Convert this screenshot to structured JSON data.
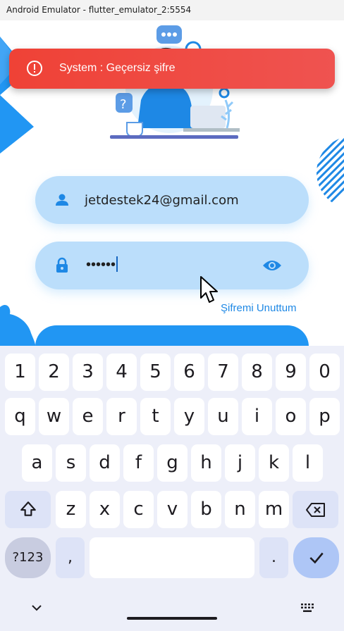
{
  "window": {
    "title": "Android Emulator - flutter_emulator_2:5554"
  },
  "snackbar": {
    "message": "System : Geçersiz şifre"
  },
  "login": {
    "email_value": "jetdestek24@gmail.com",
    "password_masked": "••••••",
    "forgot_label": "Şifremi Unuttum",
    "login_button_label": ""
  },
  "keyboard": {
    "number_row": [
      "1",
      "2",
      "3",
      "4",
      "5",
      "6",
      "7",
      "8",
      "9",
      "0"
    ],
    "row1": [
      "q",
      "w",
      "e",
      "r",
      "t",
      "y",
      "u",
      "i",
      "o",
      "p"
    ],
    "row2": [
      "a",
      "s",
      "d",
      "f",
      "g",
      "h",
      "j",
      "k",
      "l"
    ],
    "row3": [
      "z",
      "x",
      "c",
      "v",
      "b",
      "n",
      "m"
    ],
    "symbols_label": "?123",
    "comma_label": ",",
    "period_label": "."
  },
  "colors": {
    "accent": "#2196f3",
    "field_bg": "#bbdefb",
    "snackbar": "#ef4236",
    "keyboard_bg": "#edeff9"
  },
  "icons": {
    "snackbar": "error-outline-icon",
    "email": "person-icon",
    "password": "lock-icon",
    "visibility": "eye-icon",
    "shift": "shift-icon",
    "backspace": "backspace-icon",
    "enter": "checkmark-icon",
    "hide_keyboard": "chevron-down-icon",
    "switch_keyboard": "keyboard-icon"
  }
}
